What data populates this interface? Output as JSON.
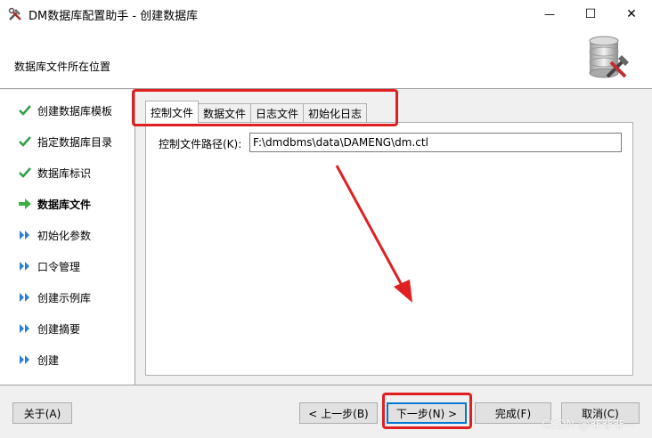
{
  "window": {
    "title": "DM数据库配置助手 - 创建数据库",
    "minimize_glyph": "—",
    "maximize_glyph": "☐",
    "close_glyph": "✕"
  },
  "header": {
    "section_label": "数据库文件所在位置"
  },
  "sidebar": {
    "items": [
      {
        "label": "创建数据库模板",
        "state": "done"
      },
      {
        "label": "指定数据库目录",
        "state": "done"
      },
      {
        "label": "数据库标识",
        "state": "done"
      },
      {
        "label": "数据库文件",
        "state": "current"
      },
      {
        "label": "初始化参数",
        "state": "pending"
      },
      {
        "label": "口令管理",
        "state": "pending"
      },
      {
        "label": "创建示例库",
        "state": "pending"
      },
      {
        "label": "创建摘要",
        "state": "pending"
      },
      {
        "label": "创建",
        "state": "pending"
      }
    ]
  },
  "tabs": [
    {
      "label": "控制文件",
      "selected": true
    },
    {
      "label": "数据文件",
      "selected": false
    },
    {
      "label": "日志文件",
      "selected": false
    },
    {
      "label": "初始化日志",
      "selected": false
    }
  ],
  "form": {
    "control_file_label": "控制文件路径(K):",
    "control_file_value": "F:\\dmdbms\\data\\DAMENG\\dm.ctl"
  },
  "buttons": {
    "about": "关于(A)",
    "prev": "< 上一步(B)",
    "next": "下一步(N) >",
    "finish": "完成(F)",
    "cancel": "取消(C)"
  },
  "watermark": "CSDN @非非非~",
  "colors": {
    "highlight": "#e02020",
    "check": "#2ea043",
    "current_arrow": "#3cb043",
    "pending": "#2a7fd4"
  }
}
